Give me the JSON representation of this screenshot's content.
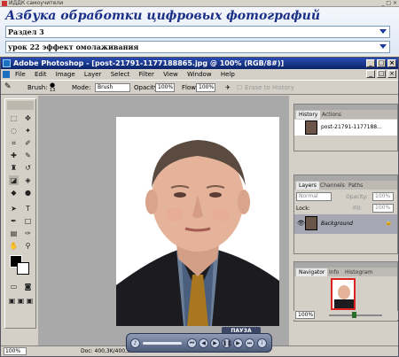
{
  "outer": {
    "title": "ИДДК самоучители",
    "controls": "_ □ ×"
  },
  "header": {
    "title": "Азбука обработки цифровых фотографий",
    "section": "Раздел 3",
    "lesson": "урок 22 эффект омолаживания"
  },
  "ps": {
    "title": "Adobe Photoshop - [post-21791-1177188865.jpg @ 100% (RGB/8#)]",
    "menu": [
      "File",
      "Edit",
      "Image",
      "Layer",
      "Select",
      "Filter",
      "View",
      "Window",
      "Help"
    ],
    "options": {
      "brush_label": "Brush:",
      "brush_size": "13",
      "mode_label": "Mode:",
      "mode_value": "Brush",
      "opacity_label": "Opacity:",
      "opacity_value": "100%",
      "flow_label": "Flow:",
      "flow_value": "100%",
      "erase_label": "Erase to History"
    },
    "status": {
      "zoom": "100%",
      "doc": "Doc: 400,3K/400,3K"
    }
  },
  "history": {
    "tabs": [
      "History",
      "Actions"
    ],
    "item": "post-21791-1177188..."
  },
  "layers": {
    "tabs": [
      "Layers",
      "Channels",
      "Paths"
    ],
    "blend": "Normal",
    "opacity_label": "Opacity:",
    "opacity": "100%",
    "lock_label": "Lock:",
    "fill_label": "Fill:",
    "fill": "100%",
    "layer_name": "Background"
  },
  "navigator": {
    "tabs": [
      "Navigator",
      "Info",
      "Histogram"
    ],
    "zoom": "100%"
  },
  "player": {
    "pause_label": "ПАУЗА"
  },
  "colors": {
    "accent": "#1a2f86",
    "ps_title": "#0a246a",
    "canvas": "#a9a9a9"
  }
}
